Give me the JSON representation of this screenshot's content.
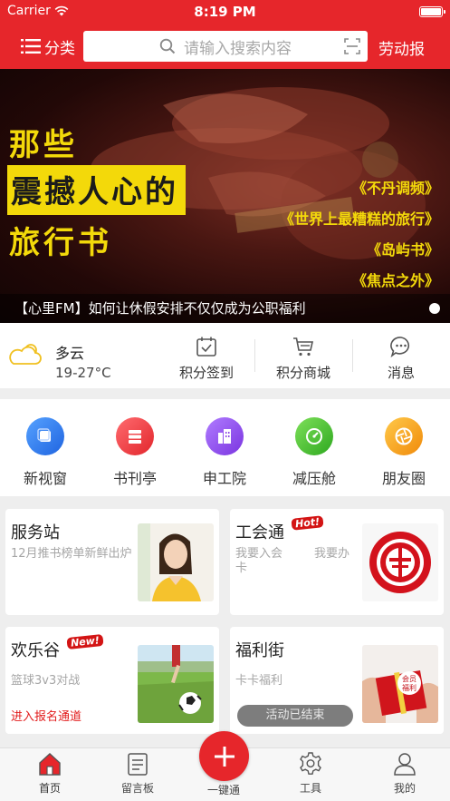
{
  "status_bar": {
    "carrier": "Carrier",
    "time": "8:19 PM"
  },
  "nav": {
    "menu_label": "分类",
    "search_placeholder": "请输入搜索内容",
    "brand": "劳动报"
  },
  "banner": {
    "headline_line1": "那些",
    "headline_line2": "震撼人心的",
    "headline_line3": "旅行书",
    "books": [
      "《不丹调频》",
      "《世界上最糟糕的旅行》",
      "《岛屿书》",
      "《焦点之外》"
    ],
    "caption": "【心里FM】如何让休假安排不仅仅成为公职福利",
    "page_indicator": {
      "current": 1,
      "total": 1
    }
  },
  "weather": {
    "condition": "多云",
    "temperature": "19-27°C",
    "icon": "cloud-sun-icon"
  },
  "quick_actions": [
    {
      "label": "积分签到",
      "icon": "calendar-check-icon"
    },
    {
      "label": "积分商城",
      "icon": "cart-icon"
    },
    {
      "label": "消息",
      "icon": "chat-bubble-icon"
    }
  ],
  "channels": [
    {
      "label": "新视窗",
      "icon": "window-icon",
      "color": "#2f7df0"
    },
    {
      "label": "书刊亭",
      "icon": "stack-icon",
      "color": "#ef3a3f"
    },
    {
      "label": "申工院",
      "icon": "building-icon",
      "color": "#8b46e6"
    },
    {
      "label": "减压舱",
      "icon": "gauge-icon",
      "color": "#38b82a"
    },
    {
      "label": "朋友圈",
      "icon": "aperture-icon",
      "color": "#f5a310"
    }
  ],
  "cards": {
    "service": {
      "title": "服务站",
      "subtitle": "12月推书榜单新鲜出炉"
    },
    "union": {
      "title": "工会通",
      "badge": "Hot!",
      "link1": "我要入会卡",
      "link2": "我要办"
    },
    "fun": {
      "title": "欢乐谷",
      "badge": "New!",
      "subtitle": "篮球3v3对战",
      "link": "进入报名通道"
    },
    "welfare": {
      "title": "福利街",
      "subtitle": "卡卡福利",
      "status": "活动已结束",
      "gift_text": "会员福利"
    }
  },
  "tabs": [
    {
      "label": "首页",
      "icon": "home-icon",
      "active": true
    },
    {
      "label": "留言板",
      "icon": "board-icon",
      "active": false
    },
    {
      "label": "一键通",
      "icon": "plus-icon",
      "active": false
    },
    {
      "label": "工具",
      "icon": "gear-icon",
      "active": false
    },
    {
      "label": "我的",
      "icon": "user-icon",
      "active": false
    }
  ],
  "colors": {
    "brand_red": "#e6262b",
    "headline_yellow": "#f3d90a"
  }
}
